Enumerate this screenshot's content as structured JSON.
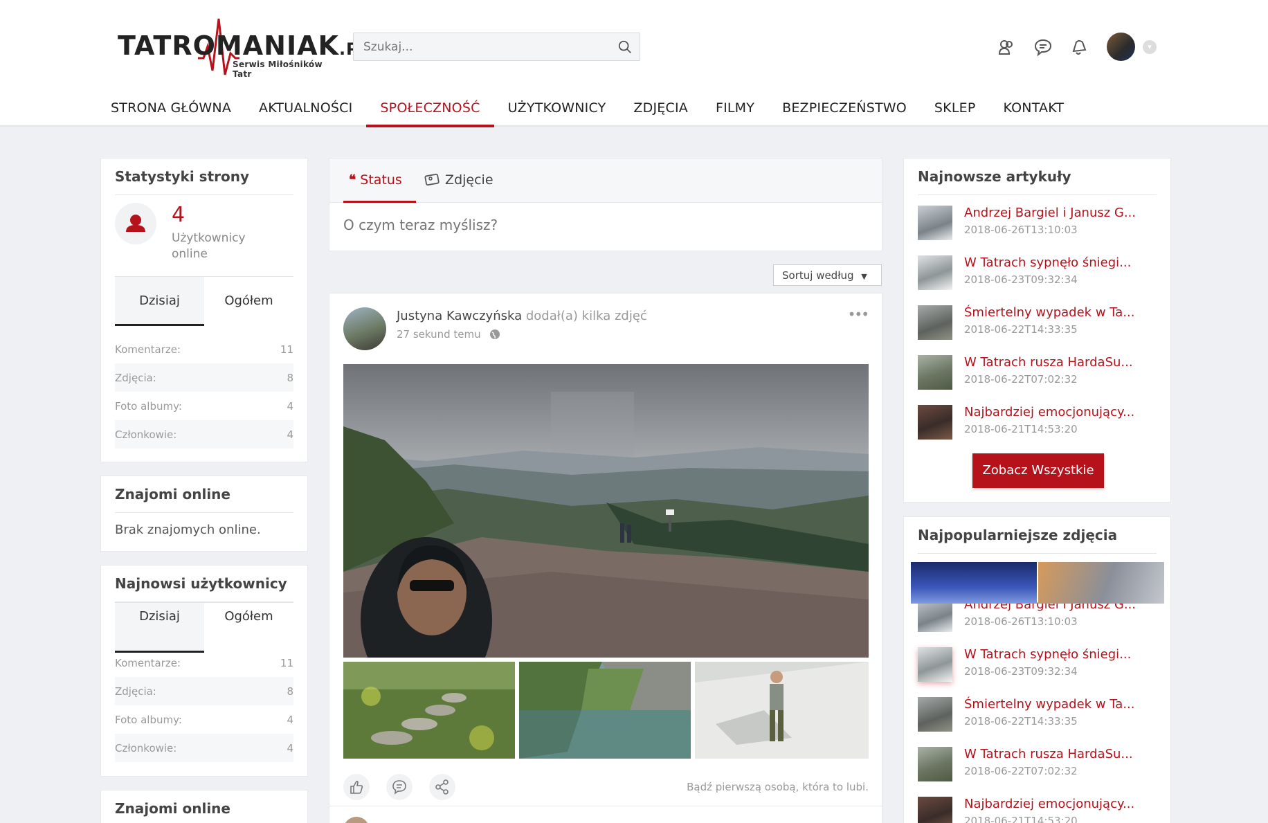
{
  "header": {
    "logo": {
      "text": "TATROMANIAK",
      "suffix": ".PL",
      "tagline": "Serwis Miłośników Tatr"
    },
    "search": {
      "placeholder": "Szukaj..."
    }
  },
  "nav": {
    "items": [
      {
        "label": "STRONA GŁÓWNA",
        "active": false
      },
      {
        "label": "AKTUALNOŚCI",
        "active": false
      },
      {
        "label": "SPOŁECZNOŚĆ",
        "active": true
      },
      {
        "label": "UŻYTKOWNICY",
        "active": false
      },
      {
        "label": "ZDJĘCIA",
        "active": false
      },
      {
        "label": "FILMY",
        "active": false
      },
      {
        "label": "BEZPIECZEŃSTWO",
        "active": false
      },
      {
        "label": "SKLEP",
        "active": false
      },
      {
        "label": "KONTAKT",
        "active": false
      }
    ]
  },
  "stats": {
    "title": "Statystyki strony",
    "online_count": "4",
    "online_label": "Użytkownicy online",
    "tabs": [
      "Dzisiaj",
      "Ogółem"
    ],
    "rows": [
      {
        "label": "Komentarze:",
        "value": "11"
      },
      {
        "label": "Zdjęcia:",
        "value": "8"
      },
      {
        "label": "Foto albumy:",
        "value": "4"
      },
      {
        "label": "Członkowie:",
        "value": "4"
      }
    ]
  },
  "friends_online": {
    "title": "Znajomi online",
    "empty": "Brak znajomych online."
  },
  "newest_users": {
    "title": "Najnowsi użytkownicy",
    "tabs": [
      "Dzisiaj",
      "Ogółem"
    ],
    "rows": [
      {
        "label": "Komentarze:",
        "value": "11"
      },
      {
        "label": "Zdjęcia:",
        "value": "8"
      },
      {
        "label": "Foto albumy:",
        "value": "4"
      },
      {
        "label": "Członkowie:",
        "value": "4"
      }
    ]
  },
  "friends_online_2": {
    "title": "Znajomi online"
  },
  "composer": {
    "tab_status": "Status",
    "tab_photo": "Zdjęcie",
    "placeholder": "O czym teraz myślisz?"
  },
  "sort": {
    "label": "Sortuj według"
  },
  "post": {
    "author": "Justyna Kawczyńska",
    "action": "dodał(a) kilka zdjęć",
    "time": "27 sekund temu",
    "likes_text": "Bądź pierwszą osobą, która to lubi."
  },
  "articles": {
    "title": "Najnowsze artykuły",
    "items": [
      {
        "title": "Andrzej Bargiel i Janusz G...",
        "date": "2018-06-26T13:10:03"
      },
      {
        "title": "W Tatrach sypnęło śniegi...",
        "date": "2018-06-23T09:32:34"
      },
      {
        "title": "Śmiertelny wypadek w Ta...",
        "date": "2018-06-22T14:33:35"
      },
      {
        "title": "W Tatrach rusza HardaSu...",
        "date": "2018-06-22T07:02:32"
      },
      {
        "title": "Najbardziej emocjonujący...",
        "date": "2018-06-21T14:53:20"
      }
    ],
    "button": "Zobacz Wszystkie"
  },
  "popular_photos": {
    "title": "Najpopularniejsze zdjęcia",
    "items": [
      {
        "title": "Andrzej Bargiel i Janusz G...",
        "date": "2018-06-26T13:10:03"
      },
      {
        "title": "W Tatrach sypnęło śniegi...",
        "date": "2018-06-23T09:32:34"
      },
      {
        "title": "Śmiertelny wypadek w Ta...",
        "date": "2018-06-22T14:33:35"
      },
      {
        "title": "W Tatrach rusza HardaSu...",
        "date": "2018-06-22T07:02:32"
      },
      {
        "title": "Najbardziej emocjonujący...",
        "date": "2018-06-21T14:53:20"
      }
    ]
  },
  "colors": {
    "accent": "#b5121b",
    "background": "#eef0f3"
  },
  "icons": [
    "search-icon",
    "friends-icon",
    "messages-icon",
    "notifications-icon",
    "quote-icon",
    "photo-icon",
    "globe-icon",
    "like-icon",
    "comment-icon",
    "share-icon",
    "user-icon"
  ]
}
